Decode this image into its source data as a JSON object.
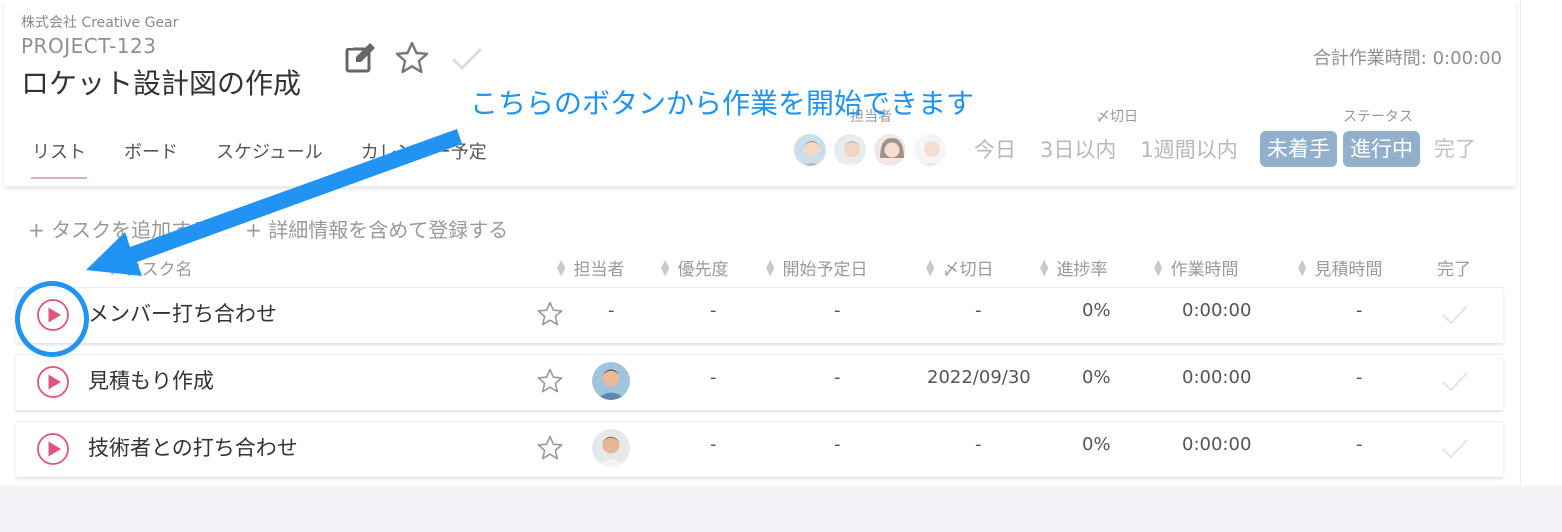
{
  "company": "株式会社 Creative Gear",
  "project": {
    "code": "PROJECT-123",
    "title": "ロケット設計図の作成"
  },
  "total_time": "合計作業時間: 0:00:00",
  "tabs": [
    "リスト",
    "ボード",
    "スケジュール",
    "カレンダー予定"
  ],
  "filters": {
    "assignee_label": "担当者",
    "deadline_label": "〆切日",
    "status_label": "ステータス",
    "deadline_options": [
      "今日",
      "3日以内",
      "1週間以内"
    ],
    "status_options": [
      "未着手",
      "進行中",
      "完了"
    ]
  },
  "add": {
    "task": "+ タスクを追加する",
    "detailed": "+ 詳細情報を含めて登録する"
  },
  "columns": {
    "task_name": "タスク名",
    "assignee": "担当者",
    "priority": "優先度",
    "start_date": "開始予定日",
    "deadline": "〆切日",
    "progress": "進捗率",
    "work_time": "作業時間",
    "estimate": "見積時間",
    "done": "完了"
  },
  "rows": [
    {
      "name": "メンバー打ち合わせ",
      "assignee": "-",
      "priority": "-",
      "start": "-",
      "deadline": "-",
      "progress": "0%",
      "work_time": "0:00:00",
      "estimate": "-"
    },
    {
      "name": "見積もり作成",
      "priority": "-",
      "start": "-",
      "deadline": "2022/09/30",
      "progress": "0%",
      "work_time": "0:00:00",
      "estimate": "-"
    },
    {
      "name": "技術者との打ち合わせ",
      "priority": "-",
      "start": "-",
      "deadline": "-",
      "progress": "0%",
      "work_time": "0:00:00",
      "estimate": "-"
    }
  ],
  "callout": "こちらのボタンから作業を開始できます",
  "colors": {
    "accent_blue": "#2193f3",
    "play_red": "#e0557a",
    "status_pill": "#92afcc"
  }
}
